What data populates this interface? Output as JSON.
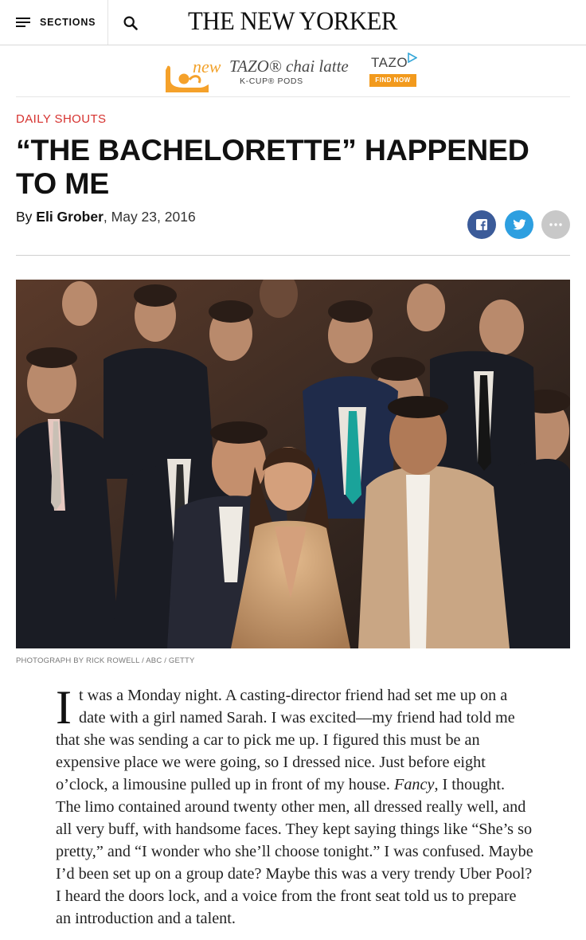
{
  "nav": {
    "sections_label": "SECTIONS",
    "masthead": "THE NEW YORKER"
  },
  "ad": {
    "new": "new",
    "product": "TAZO® chai latte",
    "format": "K-CUP® PODS",
    "brand": "TAZO",
    "cta": "FIND NOW"
  },
  "article": {
    "rubric": "DAILY SHOUTS",
    "headline": "“THE BACHELORETTE” HAPPENED TO ME",
    "byline_prefix": "By ",
    "author": "Eli Grober",
    "date": ", May 23, 2016",
    "photo_credit": "PHOTOGRAPH BY RICK ROWELL / ABC / GETTY",
    "dropcap": "I",
    "body_part1": "t was a Monday night. A casting-director friend had set me up on a date with a girl named Sarah. I was excited—my friend had told me that she was sending a car to pick me up. I figured this must be an expensive place we were going, so I dressed nice. Just before eight o’clock, a limousine pulled up in front of my house. ",
    "body_italic": "Fancy",
    "body_part2": ", I thought. The limo contained around twenty other men, all dressed really well, and all very buff, with handsome faces. They kept saying things like “She’s so pretty,” and “I wonder who she’ll choose tonight.” I was confused. Maybe I’d been set up on a group date? Maybe this was a very trendy Uber Pool? I heard the doors lock, and a voice from the front seat told us to prepare an introduction and a talent."
  },
  "icons": {
    "menu": "hamburger-icon",
    "search": "search-icon",
    "facebook": "facebook-icon",
    "twitter": "twitter-icon",
    "more": "more-icon",
    "adchoices": "adchoices-icon"
  },
  "colors": {
    "rubric": "#d6322f",
    "facebook": "#3b5b99",
    "twitter": "#2d9fe0",
    "more": "#c8c8c8",
    "ad_orange": "#f29a1d"
  }
}
